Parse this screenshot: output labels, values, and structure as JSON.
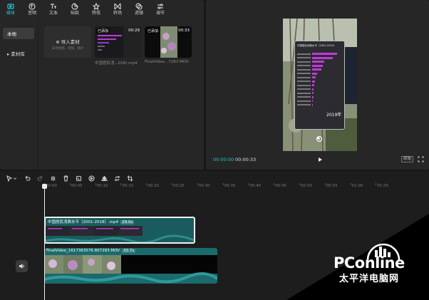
{
  "toolbar": {
    "items": [
      {
        "label": "媒体",
        "icon": "media-icon",
        "active": true
      },
      {
        "label": "音频",
        "icon": "audio-icon"
      },
      {
        "label": "文本",
        "icon": "text-icon"
      },
      {
        "label": "贴纸",
        "icon": "sticker-icon"
      },
      {
        "label": "特效",
        "icon": "effects-icon"
      },
      {
        "label": "转场",
        "icon": "transition-icon"
      },
      {
        "label": "滤镜",
        "icon": "filter-icon"
      },
      {
        "label": "调节",
        "icon": "adjust-icon"
      }
    ]
  },
  "sidebar": {
    "items": [
      {
        "label": "本地"
      },
      {
        "label": "▸ 素材库"
      }
    ]
  },
  "media": {
    "import": {
      "title": "⊕ 导入素材",
      "subtitle": "支持视频、音频、图片"
    },
    "files": [
      {
        "badge": "已添加",
        "duration": "00:29",
        "name": "中国居民消...018).mp4"
      },
      {
        "badge": "已添加",
        "duration": "00:33",
        "name": "FinalVideo...7283.MOV"
      }
    ]
  },
  "preview": {
    "current_time": "00:00:00",
    "total_time": "00:00:33",
    "ratio_label": "原始",
    "overlay_title": "中国居民消费水平（2001-2019）",
    "overlay_year": "2019年",
    "accent": "#1fc8d8",
    "bar_color": "#c03ad6",
    "bar_values": [
      0.58,
      0.48,
      0.28,
      0.25,
      0.22,
      0.12,
      0.08,
      0.07,
      0.05,
      0.04,
      0.03,
      0.03,
      0.02,
      0.02
    ]
  },
  "timeline": {
    "ticks": [
      "00:00",
      "00:05",
      "00:10",
      "00:15",
      "00:20",
      "00:25",
      "00:30",
      "00:35",
      "00:40",
      "00:45",
      "00:50",
      "00:55",
      "01:00",
      "01:05"
    ],
    "clips": [
      {
        "title": "中国居民消费水平（2001-2018）.mp4",
        "duration": "29.0s"
      },
      {
        "title": "FinalVideo_1617363576.807283.MOV",
        "duration": "33.7s"
      }
    ]
  },
  "watermark": {
    "text": "PConline",
    "subtitle": "太平洋电脑网"
  }
}
